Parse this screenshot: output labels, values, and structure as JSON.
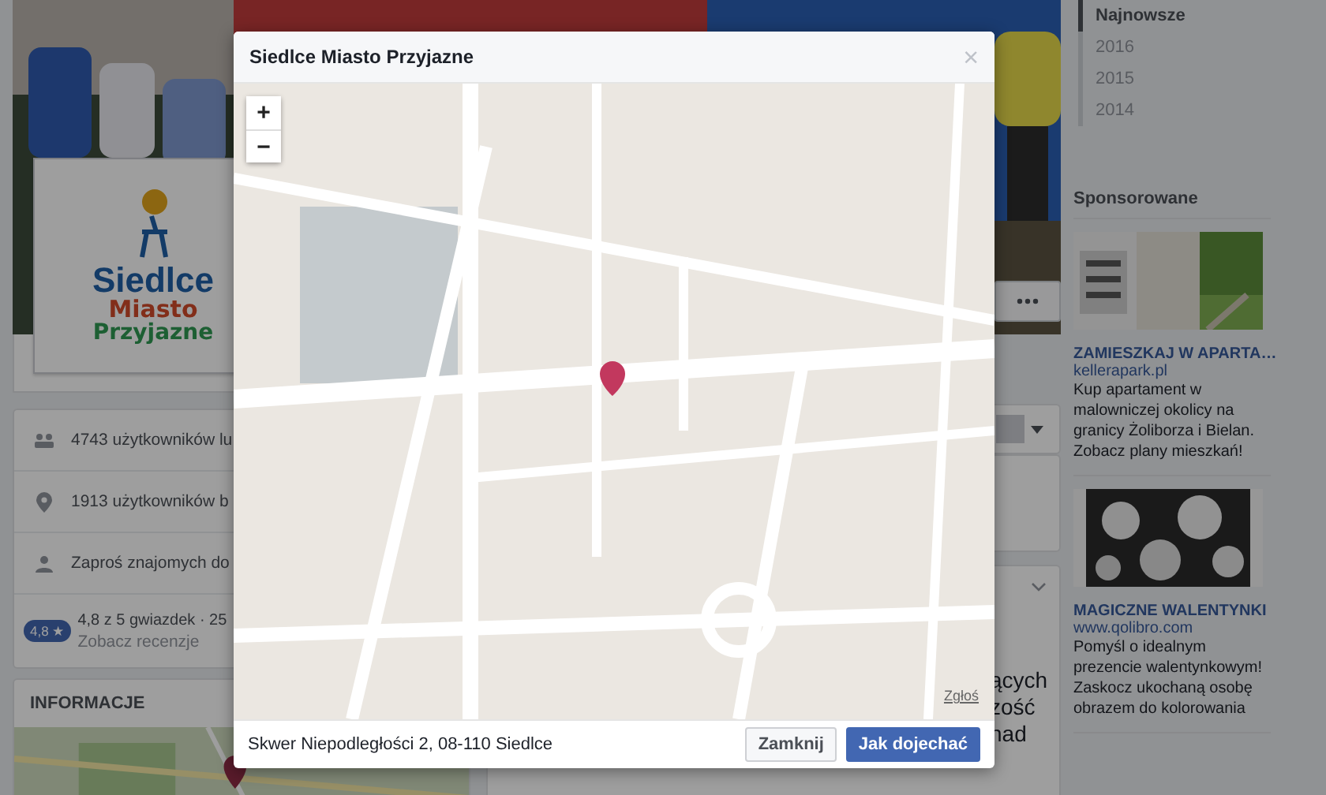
{
  "cover_logo": {
    "lines": [
      "Siedlce",
      "Miasto",
      "Przyjazne"
    ]
  },
  "info_rows": [
    {
      "kind": "likes",
      "text": "4743 użytkowników lu"
    },
    {
      "kind": "checkins",
      "text": "1913 użytkowników b"
    },
    {
      "kind": "invite",
      "text": "Zaproś znajomych do"
    }
  ],
  "rating": {
    "badge": "4,8 ★",
    "text": "4,8 z 5 gwiazdek · 25",
    "link": "Zobacz recenzje"
  },
  "about": {
    "heading": "INFORMACJE"
  },
  "post_fragment": [
    "ących",
    "zość",
    "nad"
  ],
  "timeline": [
    {
      "label": "Najnowsze",
      "selected": true
    },
    {
      "label": "2016",
      "selected": false
    },
    {
      "label": "2015",
      "selected": false
    },
    {
      "label": "2014",
      "selected": false
    }
  ],
  "sponsored": {
    "heading": "Sponsorowane",
    "ads": [
      {
        "title": "ZAMIESZKAJ W APARTA…",
        "domain": "kellerapark.pl",
        "text": "Kup apartament w malowniczej okolicy na granicy Żoliborza i Bielan. Zobacz plany mieszkań!"
      },
      {
        "title": "MAGICZNE WALENTYNKI",
        "domain": "www.qolibro.com",
        "text": "Pomyśl o idealnym prezencie walentynkowym! Zaskocz ukochaną osobę obrazem do kolorowania"
      }
    ]
  },
  "dialog": {
    "title": "Siedlce Miasto Przyjazne",
    "close": "×",
    "zoom_in": "+",
    "zoom_out": "−",
    "report_link": "Zgłoś",
    "address": "Skwer Niepodległości 2, 08-110 Siedlce",
    "buttons": [
      {
        "label": "Zamknij",
        "kind": "secondary"
      },
      {
        "label": "Jak dojechać",
        "kind": "primary"
      }
    ]
  }
}
